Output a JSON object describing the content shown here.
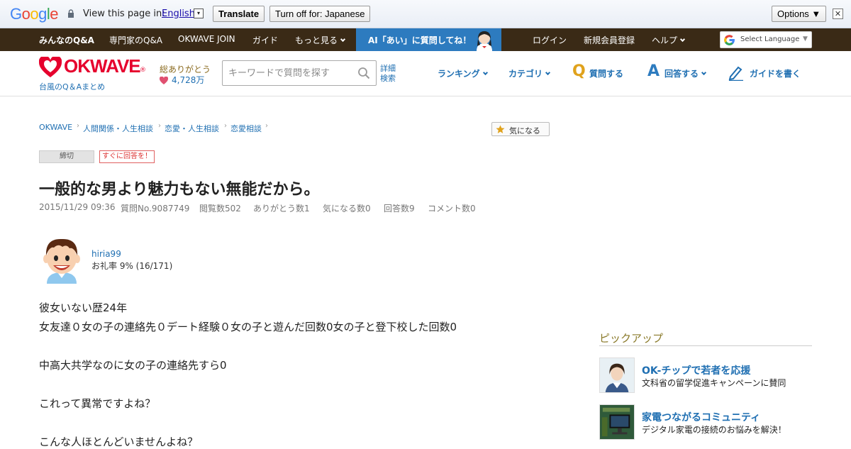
{
  "translate_bar": {
    "brand": "Google",
    "prompt": "View this page in:",
    "language": "English",
    "dropdown_glyph": "▾",
    "translate_label": "Translate",
    "turn_off_label": "Turn off for: Japanese",
    "options_label": "Options ▼",
    "close_glyph": "✕"
  },
  "top_nav": {
    "items": [
      "みんなのQ&A",
      "専門家のQ&A",
      "OKWAVE JOIN",
      "ガイド",
      "もっと見る"
    ],
    "ai_banner": "AI「あい」に質問してね！",
    "right_items": [
      "ログイン",
      "新規会員登録",
      "ヘルプ"
    ],
    "select_language": "Select Language",
    "select_arrow": "▼"
  },
  "header": {
    "logo_text": "OKWAVE",
    "logo_mark": "®",
    "logo_sub": "台風のQ＆Aまとめ",
    "thanks_label": "総ありがとう",
    "thanks_count": "4,728万",
    "search_placeholder": "キーワードで質問を探す",
    "advanced_search": "詳細検索",
    "nav": [
      "ランキング",
      "カテゴリ",
      "質問する",
      "回答する",
      "ガイドを書く"
    ],
    "q_glyph": "Q",
    "a_glyph": "A"
  },
  "breadcrumb": [
    "OKWAVE",
    "人間関係・人生相談",
    "恋愛・人生相談",
    "恋愛相談"
  ],
  "breadcrumb_sep": "›",
  "favorite_label": "気になる",
  "badges": {
    "closed": "締切",
    "urgent": "すぐに回答を！"
  },
  "question": {
    "title": "一般的な男より魅力もない無能だから。",
    "meta": [
      "2015/11/29 09:36",
      "質問No.9087749",
      "閲覧数502",
      "ありがとう数1",
      "気になる数0",
      "回答数9",
      "コメント数0"
    ],
    "user_name": "hiria99",
    "user_rate": "お礼率 9%  (16/171)",
    "body": [
      "彼女いない歴24年",
      "女友達０女の子の連絡先０デート経験０女の子と遊んだ回数0女の子と登下校した回数0",
      "中高大共学なのに女の子の連絡先すら0",
      "これって異常ですよね？",
      "こんな人ほとんどいませんよね？"
    ]
  },
  "pickup": {
    "title": "ピックアップ",
    "items": [
      {
        "head": "OK-チップで若者を応援",
        "desc": "文科省の留学促進キャンペーンに賛同"
      },
      {
        "head": "家電つながるコミュニティ",
        "desc": "デジタル家電の接続のお悩みを解決！"
      }
    ]
  },
  "colors": {
    "nav_bg": "#3a2a16",
    "ai_bg": "#2d7bbf",
    "brand_red": "#e6002d",
    "link": "#1f6fb2"
  }
}
